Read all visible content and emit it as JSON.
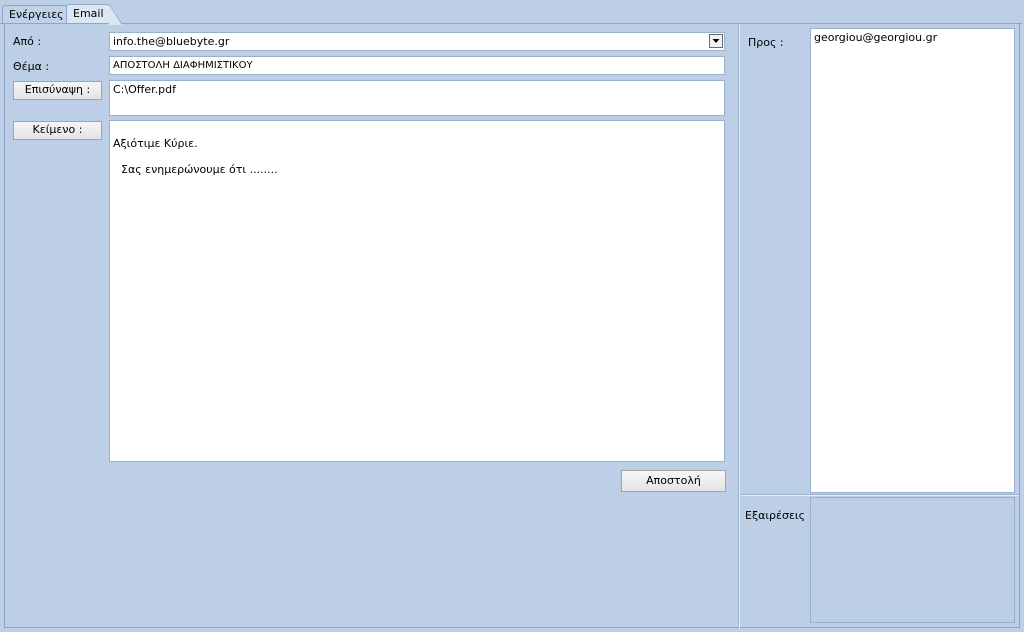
{
  "tabs": [
    {
      "label": "Ενέργειες",
      "active": false
    },
    {
      "label": "Email",
      "active": true
    }
  ],
  "email_form": {
    "from_label": "Από :",
    "from_value": "info.the@bluebyte.gr",
    "subject_label": "Θέμα :",
    "subject_value": "ΑΠΟΣΤΟΛΗ ΔΙΑΦΗΜΙΣΤΙΚΟΥ",
    "attachment_button": "Επισύναψη :",
    "attachment_value": "C:\\Offer.pdf",
    "text_button": "Κείμενο :",
    "body_lines": [
      "Αξιότιμε Κύριε.",
      "Σας ενημερώνουμε ότι ........"
    ],
    "send_button": "Αποστολή"
  },
  "recipients": {
    "to_label": "Προς :",
    "to_value": "georgiou@georgiou.gr",
    "exclusions_label": "Εξαιρέσεις :",
    "exclusions_value": ""
  },
  "colors": {
    "background": "#bccfe6",
    "border": "#8ea6c4",
    "field": "#ffffff"
  }
}
